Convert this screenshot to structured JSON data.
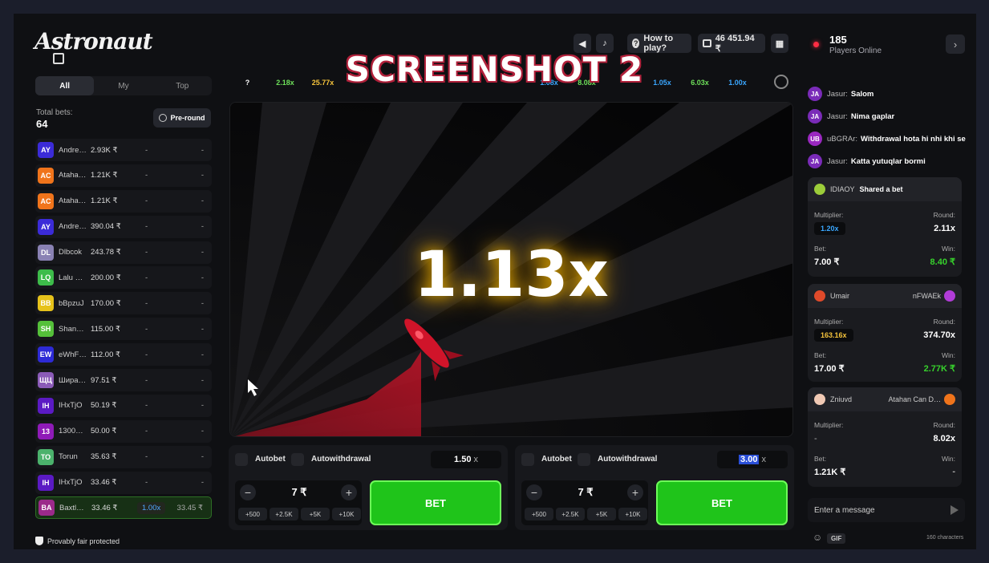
{
  "overlay": {
    "title": "SCREENSHOT 2"
  },
  "header": {
    "logo": "Astronaut",
    "how_to_play": "How to play?",
    "balance": "46 451.94 ₹",
    "players_online_count": "185",
    "players_online_label": "Players Online",
    "icons": [
      "sound-icon",
      "music-icon",
      "help-icon",
      "wallet-icon",
      "menu-grid-icon",
      "chevron-right-icon"
    ]
  },
  "left": {
    "tabs": [
      "All",
      "My",
      "Top"
    ],
    "total_bets_label": "Total bets:",
    "total_bets_value": "64",
    "pre_round": "Pre-round",
    "bets": [
      {
        "initials": "AY",
        "color": "#3b2bd8",
        "name": "Andre…",
        "amount": "2.93K ₹",
        "mult": "-",
        "win": "-"
      },
      {
        "initials": "AC",
        "color": "#f0741b",
        "name": "Ataha…",
        "amount": "1.21K ₹",
        "mult": "-",
        "win": "-"
      },
      {
        "initials": "AC",
        "color": "#f0741b",
        "name": "Ataha…",
        "amount": "1.21K ₹",
        "mult": "-",
        "win": "-"
      },
      {
        "initials": "AY",
        "color": "#3b2bd8",
        "name": "Andre…",
        "amount": "390.04 ₹",
        "mult": "-",
        "win": "-"
      },
      {
        "initials": "DL",
        "color": "#8a82b4",
        "name": "Dlbcok",
        "amount": "243.78 ₹",
        "mult": "-",
        "win": "-"
      },
      {
        "initials": "LQ",
        "color": "#3dbc4a",
        "name": "Lalu …",
        "amount": "200.00 ₹",
        "mult": "-",
        "win": "-"
      },
      {
        "initials": "BB",
        "color": "#e6c21b",
        "name": "bBpzuJ",
        "amount": "170.00 ₹",
        "mult": "-",
        "win": "-"
      },
      {
        "initials": "SH",
        "color": "#55c03a",
        "name": "Shan…",
        "amount": "115.00 ₹",
        "mult": "-",
        "win": "-"
      },
      {
        "initials": "EW",
        "color": "#2d2ad6",
        "name": "eWhF…",
        "amount": "112.00 ₹",
        "mult": "-",
        "win": "-"
      },
      {
        "initials": "ЩЦ",
        "color": "#8b5bb8",
        "name": "Шира…",
        "amount": "97.51 ₹",
        "mult": "-",
        "win": "-"
      },
      {
        "initials": "IH",
        "color": "#5b1ac4",
        "name": "IHxTjO",
        "amount": "50.19 ₹",
        "mult": "-",
        "win": "-"
      },
      {
        "initials": "13",
        "color": "#8f1bb8",
        "name": "1300…",
        "amount": "50.00 ₹",
        "mult": "-",
        "win": "-"
      },
      {
        "initials": "TO",
        "color": "#4bb26c",
        "name": "Torun",
        "amount": "35.63 ₹",
        "mult": "-",
        "win": "-"
      },
      {
        "initials": "IH",
        "color": "#5b1ac4",
        "name": "IHxTjO",
        "amount": "33.46 ₹",
        "mult": "-",
        "win": "-"
      },
      {
        "initials": "BA",
        "color": "#9b2a8a",
        "name": "Baxtl…",
        "amount": "33.46 ₹",
        "mult": "1.00x",
        "win": "33.45 ₹"
      }
    ],
    "provably_fair": "Provably fair protected"
  },
  "history": [
    {
      "value": "?",
      "color": "#ffffff"
    },
    {
      "value": "2.18x",
      "color": "#6ee05a"
    },
    {
      "value": "25.77x",
      "color": "#f5c33b"
    },
    {
      "value": "",
      "color": "#ffffff"
    },
    {
      "value": "",
      "color": "#ffffff"
    },
    {
      "value": "",
      "color": "#ffffff"
    },
    {
      "value": "",
      "color": "#ffffff"
    },
    {
      "value": "",
      "color": "#ffffff"
    },
    {
      "value": "1.08x",
      "color": "#3aa7ff"
    },
    {
      "value": "8.08x",
      "color": "#6ee05a"
    },
    {
      "value": "",
      "color": "#ffffff"
    },
    {
      "value": "1.05x",
      "color": "#3aa7ff"
    },
    {
      "value": "6.03x",
      "color": "#6ee05a"
    },
    {
      "value": "1.00x",
      "color": "#3aa7ff"
    }
  ],
  "game": {
    "multiplier": "1.13x"
  },
  "bet_panels": [
    {
      "autobet": "Autobet",
      "autowithdrawal": "Autowithdrawal",
      "auto_value": "1.50",
      "auto_x": "x",
      "stake": "7 ₹",
      "quick": [
        "+500",
        "+2.5K",
        "+5K",
        "+10K"
      ],
      "bet_label": "BET"
    },
    {
      "autobet": "Autobet",
      "autowithdrawal": "Autowithdrawal",
      "auto_value": "3.00",
      "auto_x": "x",
      "stake": "7 ₹",
      "quick": [
        "+500",
        "+2.5K",
        "+5K",
        "+10K"
      ],
      "bet_label": "BET"
    }
  ],
  "chat": {
    "messages": [
      {
        "initials": "JA",
        "color": "#7a2bb8",
        "user": "Jasur:",
        "text": "Salom"
      },
      {
        "initials": "JA",
        "color": "#7a2bb8",
        "user": "Jasur:",
        "text": "Nima gaplar"
      },
      {
        "initials": "UB",
        "color": "#9a28c0",
        "user": "uBGRAr:",
        "text": "Withdrawal hota hi nhi khi se"
      },
      {
        "initials": "JA",
        "color": "#7a2bb8",
        "user": "Jasur:",
        "text": "Katta yutuqlar bormi"
      }
    ],
    "cards": [
      {
        "user": "IDIAOY",
        "action": "Shared a bet",
        "opponent": "",
        "av_color": "#9ccd3a",
        "multiplier_label": "Multiplier:",
        "multiplier": "1.20x",
        "mult_color": "#3aa7ff",
        "round_label": "Round:",
        "round": "2.11x",
        "bet_label": "Bet:",
        "bet": "7.00 ₹",
        "win_label": "Win:",
        "win": "8.40 ₹",
        "win_color": "#37d12c"
      },
      {
        "user": "Umair",
        "action": "",
        "opponent": "nFWAEk",
        "av_color": "#e04a2a",
        "multiplier_label": "Multiplier:",
        "multiplier": "163.16x",
        "mult_color": "#f5c33b",
        "round_label": "Round:",
        "round": "374.70x",
        "bet_label": "Bet:",
        "bet": "17.00 ₹",
        "win_label": "Win:",
        "win": "2.77K ₹",
        "win_color": "#37d12c"
      },
      {
        "user": "Zniuvd",
        "action": "",
        "opponent": "Atahan Can D…",
        "av_color": "#f0c9b4",
        "multiplier_label": "Multiplier:",
        "multiplier": "-",
        "mult_color": "#aaaaaa",
        "round_label": "Round:",
        "round": "8.02x",
        "bet_label": "Bet:",
        "bet": "1.21K ₹",
        "win_label": "Win:",
        "win": "-",
        "win_color": "#aaaaaa"
      }
    ],
    "input_placeholder": "Enter a message",
    "gif_label": "GIF",
    "char_limit": "160 characters"
  }
}
